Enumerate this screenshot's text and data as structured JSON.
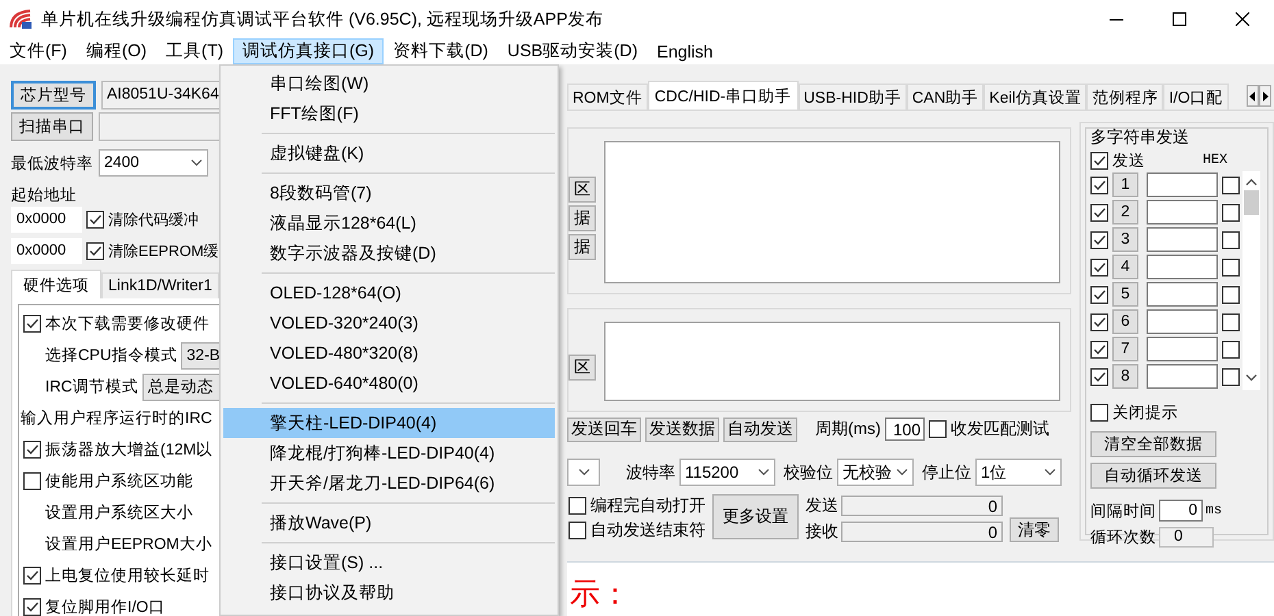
{
  "window": {
    "title": "单片机在线升级编程仿真调试平台软件 (V6.95C), 远程现场升级APP发布"
  },
  "menu_bar": [
    {
      "label": "文件(F)",
      "selected": false
    },
    {
      "label": "编程(O)",
      "selected": false
    },
    {
      "label": "工具(T)",
      "selected": false
    },
    {
      "label": "调试仿真接口(G)",
      "selected": true
    },
    {
      "label": "资料下载(D)",
      "selected": false
    },
    {
      "label": "USB驱动安装(D)",
      "selected": false
    },
    {
      "label": "English",
      "selected": false
    }
  ],
  "dropdown": {
    "items": [
      {
        "kind": "item",
        "label": "串口绘图(W)",
        "selected": false
      },
      {
        "kind": "item",
        "label": "FFT绘图(F)",
        "selected": false
      },
      {
        "kind": "separator"
      },
      {
        "kind": "item",
        "label": "虚拟键盘(K)",
        "selected": false
      },
      {
        "kind": "separator"
      },
      {
        "kind": "item",
        "label": "8段数码管(7)",
        "selected": false
      },
      {
        "kind": "item",
        "label": "液晶显示128*64(L)",
        "selected": false
      },
      {
        "kind": "item",
        "label": "数字示波器及按键(D)",
        "selected": false
      },
      {
        "kind": "separator"
      },
      {
        "kind": "item",
        "label": "OLED-128*64(O)",
        "selected": false
      },
      {
        "kind": "item",
        "label": "VOLED-320*240(3)",
        "selected": false
      },
      {
        "kind": "item",
        "label": "VOLED-480*320(8)",
        "selected": false
      },
      {
        "kind": "item",
        "label": "VOLED-640*480(0)",
        "selected": false
      },
      {
        "kind": "separator"
      },
      {
        "kind": "item",
        "label": "擎天柱-LED-DIP40(4)",
        "selected": true
      },
      {
        "kind": "item",
        "label": "降龙棍/打狗棒-LED-DIP40(4)",
        "selected": false
      },
      {
        "kind": "item",
        "label": "开天斧/屠龙刀-LED-DIP64(6)",
        "selected": false
      },
      {
        "kind": "separator"
      },
      {
        "kind": "item",
        "label": "播放Wave(P)",
        "selected": false
      },
      {
        "kind": "separator"
      },
      {
        "kind": "item",
        "label": "接口设置(S) ...",
        "selected": false
      },
      {
        "kind": "item",
        "label": "接口协议及帮助",
        "selected": false
      }
    ]
  },
  "left_panel": {
    "chip_button": "芯片型号",
    "chip_value": "AI8051U-34K64",
    "scan_button": "扫描串口",
    "baud_label": "最低波特率",
    "baud_value": "2400",
    "start_label": "起始地址",
    "address_rows": [
      {
        "value": "0x0000",
        "label": "清除代码缓冲",
        "checked": true
      },
      {
        "value": "0x0000",
        "label": "清除EEPROM缓",
        "checked": true
      }
    ],
    "tabs": [
      {
        "label": "硬件选项",
        "selected": true
      },
      {
        "label": "Link1D/Writer1",
        "selected": false
      }
    ],
    "options": [
      {
        "kind": "checkbox",
        "label": "本次下载需要修改硬件",
        "checked": true
      },
      {
        "kind": "select",
        "label": "选择CPU指令模式",
        "value": "32-B"
      },
      {
        "kind": "select",
        "label": "IRC调节模式",
        "value": "总是动态"
      },
      {
        "kind": "text",
        "label": "输入用户程序运行时的IRC"
      },
      {
        "kind": "checkbox",
        "label": "振荡器放大增益(12M以",
        "checked": true
      },
      {
        "kind": "checkbox",
        "label": "使能用户系统区功能",
        "checked": false
      },
      {
        "kind": "setting",
        "label": "设置用户系统区大小"
      },
      {
        "kind": "setting",
        "label": "设置用户EEPROM大小"
      },
      {
        "kind": "checkbox",
        "label": "上电复位使用较长延时",
        "checked": true
      },
      {
        "kind": "checkbox",
        "label": "复位脚用作I/O口",
        "checked": true
      }
    ]
  },
  "main_tabs": [
    {
      "label": "ROM文件",
      "selected": false
    },
    {
      "label": "CDC/HID-串口助手",
      "selected": true
    },
    {
      "label": "USB-HID助手",
      "selected": false
    },
    {
      "label": "CAN助手",
      "selected": false
    },
    {
      "label": "Keil仿真设置",
      "selected": false
    },
    {
      "label": "范例程序",
      "selected": false
    },
    {
      "label": "I/O口配",
      "selected": false
    }
  ],
  "receive": {
    "buttons": [
      "区",
      "据",
      "据"
    ]
  },
  "send": {
    "buttons": [
      "区"
    ]
  },
  "send_row": {
    "buttons": [
      "发送回车",
      "发送数据",
      "自动发送"
    ],
    "period_label": "周期(ms)",
    "period_value": "100",
    "match_test": {
      "label": "收发匹配测试",
      "checked": false
    }
  },
  "port_row": {
    "selects": [
      {
        "label": "波特率",
        "value": "115200"
      },
      {
        "label": "校验位",
        "value": "无校验"
      },
      {
        "label": "停止位",
        "value": "1位"
      }
    ]
  },
  "bottom_row": {
    "checkboxes": [
      {
        "label": "编程完自动打开",
        "checked": false
      },
      {
        "label": "自动发送结束符",
        "checked": false
      }
    ],
    "more_button": "更多设置",
    "counters": [
      {
        "label": "发送",
        "value": "0"
      },
      {
        "label": "接收",
        "value": "0"
      }
    ],
    "clear_button": "清零"
  },
  "notice": "示：",
  "multi_send": {
    "title": "多字符串发送",
    "send_all": {
      "label": "发送",
      "checked": true
    },
    "hex_label": "HEX",
    "rows": [
      {
        "number": "1",
        "checked": true,
        "hex": false
      },
      {
        "number": "2",
        "checked": true,
        "hex": false
      },
      {
        "number": "3",
        "checked": true,
        "hex": false
      },
      {
        "number": "4",
        "checked": true,
        "hex": false
      },
      {
        "number": "5",
        "checked": true,
        "hex": false
      },
      {
        "number": "6",
        "checked": true,
        "hex": false
      },
      {
        "number": "7",
        "checked": true,
        "hex": false
      },
      {
        "number": "8",
        "checked": true,
        "hex": false
      }
    ],
    "close_tips": {
      "label": "关闭提示",
      "checked": false
    },
    "buttons": [
      "清空全部数据",
      "自动循环发送"
    ],
    "interval_label": "间隔时间",
    "interval_value": "0",
    "interval_unit": "ms",
    "loop_label": "循环次数",
    "loop_value": "0"
  }
}
